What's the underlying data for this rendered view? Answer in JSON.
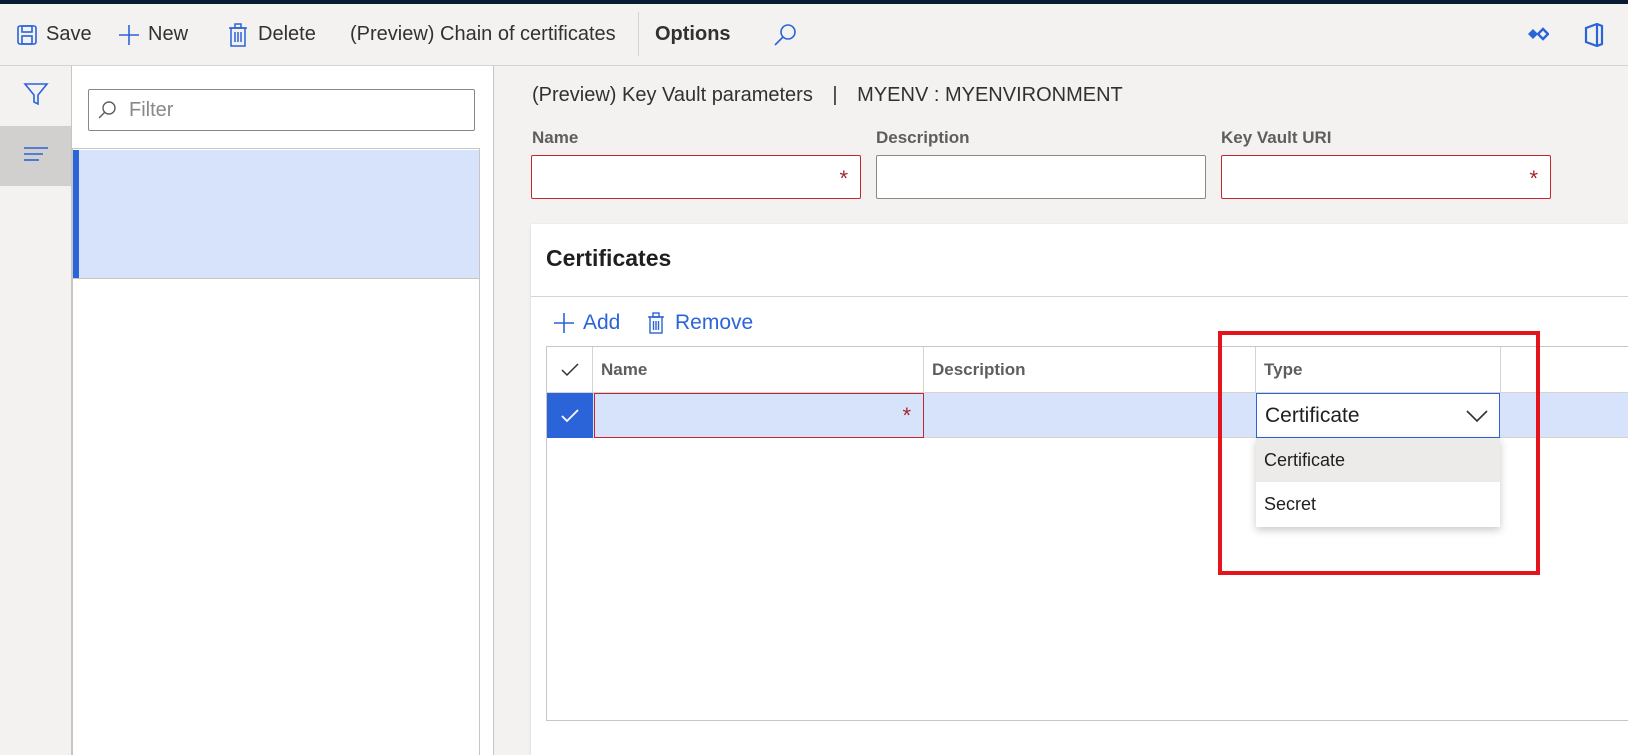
{
  "toolbar": {
    "save_label": "Save",
    "new_label": "New",
    "delete_label": "Delete",
    "chain_label": "(Preview) Chain of certificates",
    "options_label": "Options"
  },
  "filter": {
    "placeholder": "Filter"
  },
  "header": {
    "title": "(Preview) Key Vault parameters",
    "separator": "|",
    "environment": "MYENV : MYENVIRONMENT"
  },
  "fields": {
    "name_label": "Name",
    "description_label": "Description",
    "uri_label": "Key Vault URI",
    "required_mark": "*"
  },
  "certificates": {
    "title": "Certificates",
    "add_label": "Add",
    "remove_label": "Remove",
    "columns": [
      "Name",
      "Description",
      "Type"
    ],
    "row": {
      "type_value": "Certificate"
    },
    "type_options": [
      "Certificate",
      "Secret"
    ]
  },
  "colors": {
    "accent": "#2b63d9",
    "required_border": "#c4262e",
    "highlight_box": "#e3141b",
    "selected_row": "#d6e3fb"
  }
}
